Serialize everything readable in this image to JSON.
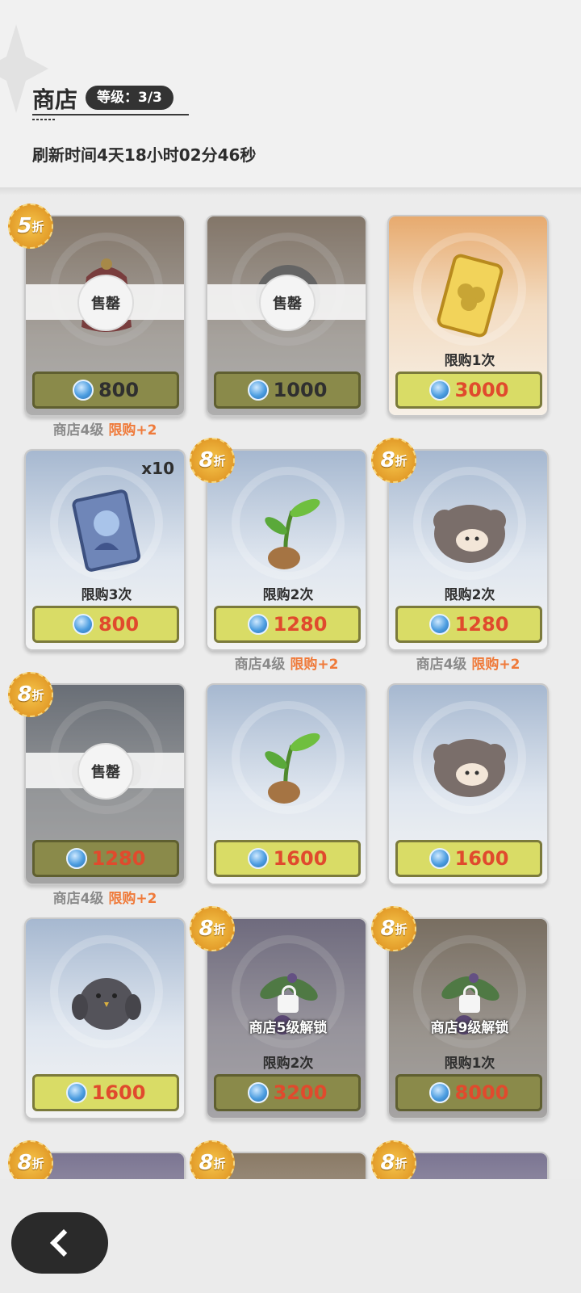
{
  "header": {
    "title": "商店",
    "level_badge": "等级：3/3",
    "refresh": "刷新时间4天18小时02分46秒"
  },
  "labels": {
    "sold_out": "售罄",
    "shop_level_note": "商店4级",
    "limit_plus": "限购+2",
    "discount_suffix": "折"
  },
  "cards": [
    {
      "price": "800",
      "limit": "",
      "discount": "5",
      "sold": true,
      "qty": "",
      "lock": "",
      "note": true,
      "item": "bell"
    },
    {
      "price": "1000",
      "limit": "",
      "discount": "",
      "sold": true,
      "qty": "",
      "lock": "",
      "note": false,
      "item": "gear"
    },
    {
      "price": "3000",
      "limit": "限购1次",
      "discount": "",
      "sold": false,
      "qty": "",
      "lock": "",
      "note": false,
      "item": "clover-card"
    },
    {
      "price": "800",
      "limit": "限购3次",
      "discount": "",
      "sold": false,
      "qty": "x10",
      "lock": "",
      "note": false,
      "item": "character-card"
    },
    {
      "price": "1280",
      "limit": "限购2次",
      "discount": "8",
      "sold": false,
      "qty": "",
      "lock": "",
      "note": true,
      "item": "sprout"
    },
    {
      "price": "1280",
      "limit": "限购2次",
      "discount": "8",
      "sold": false,
      "qty": "",
      "lock": "",
      "note": true,
      "item": "sheep"
    },
    {
      "price": "1280",
      "limit": "",
      "discount": "8",
      "sold": true,
      "qty": "",
      "lock": "",
      "note": true,
      "item": "bird-dark"
    },
    {
      "price": "1600",
      "limit": "",
      "discount": "",
      "sold": false,
      "qty": "",
      "lock": "",
      "note": false,
      "item": "sprout"
    },
    {
      "price": "1600",
      "limit": "",
      "discount": "",
      "sold": false,
      "qty": "",
      "lock": "",
      "note": false,
      "item": "sheep"
    },
    {
      "price": "1600",
      "limit": "",
      "discount": "",
      "sold": false,
      "qty": "",
      "lock": "",
      "note": false,
      "item": "bird"
    },
    {
      "price": "3200",
      "limit": "限购2次",
      "discount": "8",
      "sold": false,
      "qty": "",
      "lock": "商店5级解锁",
      "note": false,
      "item": "plant"
    },
    {
      "price": "8000",
      "limit": "限购1次",
      "discount": "8",
      "sold": false,
      "qty": "",
      "lock": "商店9级解锁",
      "note": false,
      "item": "plant"
    }
  ],
  "partial_discounts": [
    "8",
    "8",
    "8"
  ]
}
